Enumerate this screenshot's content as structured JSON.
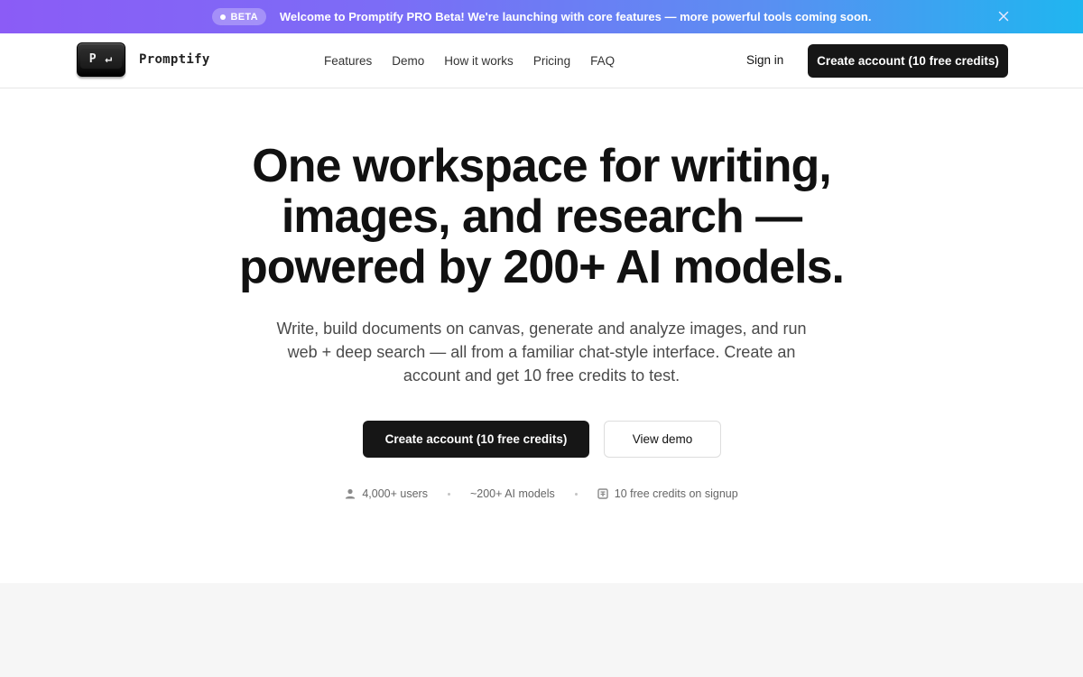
{
  "announcement": {
    "badge": "BETA",
    "text": "Welcome to Promptify PRO Beta! We're launching with core features — more powerful tools coming soon.",
    "gradient_start": "#8b5cf6",
    "gradient_end": "#1fb6f0",
    "close_icon": "close-icon"
  },
  "header": {
    "logo_key": "P ↵",
    "brand": "Promptify",
    "nav": [
      "Features",
      "Demo",
      "How it works",
      "Pricing",
      "FAQ"
    ],
    "sign_in": "Sign in",
    "cta": "Create account (10 free credits)"
  },
  "hero": {
    "title_lines": [
      "One workspace for writing,",
      "images, and research —",
      "powered by 200+ AI models."
    ],
    "subtitle_lines": [
      "Write, build documents on canvas, generate and analyze images, and run",
      "web + deep search — all from a familiar chat-style interface. Create an",
      "account and get 10 free credits to test."
    ],
    "primary_cta": "Create account (10 free credits)",
    "secondary_cta": "View demo"
  },
  "stats": [
    {
      "icon": "user-icon",
      "text": "4,000+ users"
    },
    {
      "icon": "",
      "text": "~200+ AI models"
    },
    {
      "icon": "gift-card-icon",
      "text": "10 free credits on signup"
    }
  ],
  "colors": {
    "primary_button": "#161616",
    "text": "#111111",
    "muted_text": "#666666",
    "band": "#f6f6f6"
  }
}
